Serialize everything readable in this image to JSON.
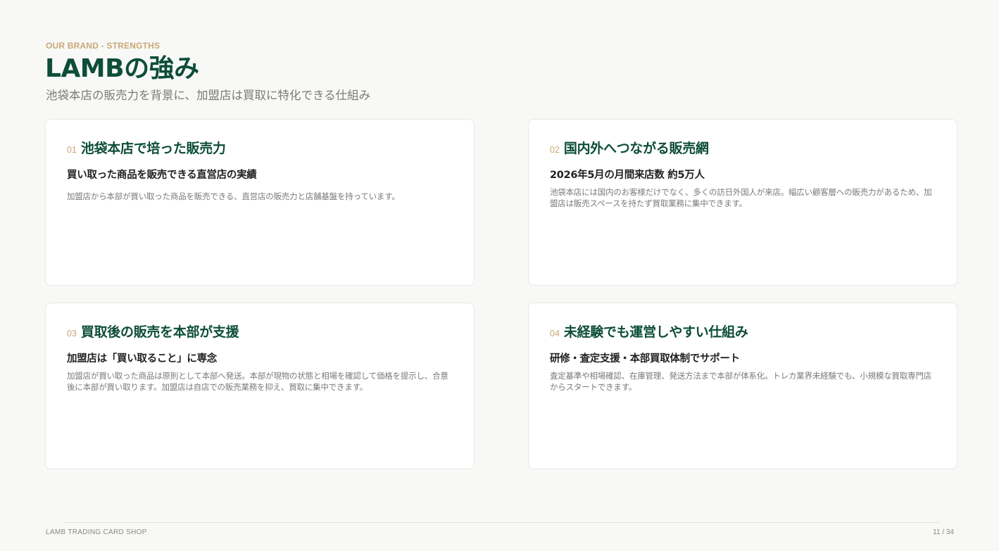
{
  "header": {
    "eyebrow": "OUR BRAND - STRENGTHS",
    "title": "LAMBの強み",
    "subtitle": "池袋本店の販売力を背景に、加盟店は買取に特化できる仕組み"
  },
  "cards": [
    {
      "number": "01",
      "title": "池袋本店で培った販売力",
      "subtitle": "買い取った商品を販売できる直営店の実績",
      "body": "加盟店から本部が買い取った商品を販売できる、直営店の販売力と店舗基盤を持っています。"
    },
    {
      "number": "02",
      "title": "国内外へつながる販売網",
      "subtitle": "2026年5月の月間来店数 約5万人",
      "body": "池袋本店には国内のお客様だけでなく、多くの訪日外国人が来店。幅広い顧客層への販売力があるため、加盟店は販売スペースを持たず買取業務に集中できます。"
    },
    {
      "number": "03",
      "title": "買取後の販売を本部が支援",
      "subtitle": "加盟店は「買い取ること」に専念",
      "body": "加盟店が買い取った商品は原則として本部へ発送。本部が現物の状態と相場を確認して価格を提示し、合意後に本部が買い取ります。加盟店は自店での販売業務を抑え、買取に集中できます。"
    },
    {
      "number": "04",
      "title": "未経験でも運営しやすい仕組み",
      "subtitle": "研修・査定支援・本部買取体制でサポート",
      "body": "査定基準や相場確認、在庫管理、発送方法まで本部が体系化。トレカ業界未経験でも、小規模な買取専門店からスタートできます。"
    }
  ],
  "footer": {
    "brand": "LAMB TRADING CARD SHOP",
    "page": "11 / 34"
  },
  "colors": {
    "accent_green": "#0d4d3a",
    "accent_gold": "#c9a877",
    "background": "#f8f8f6"
  }
}
